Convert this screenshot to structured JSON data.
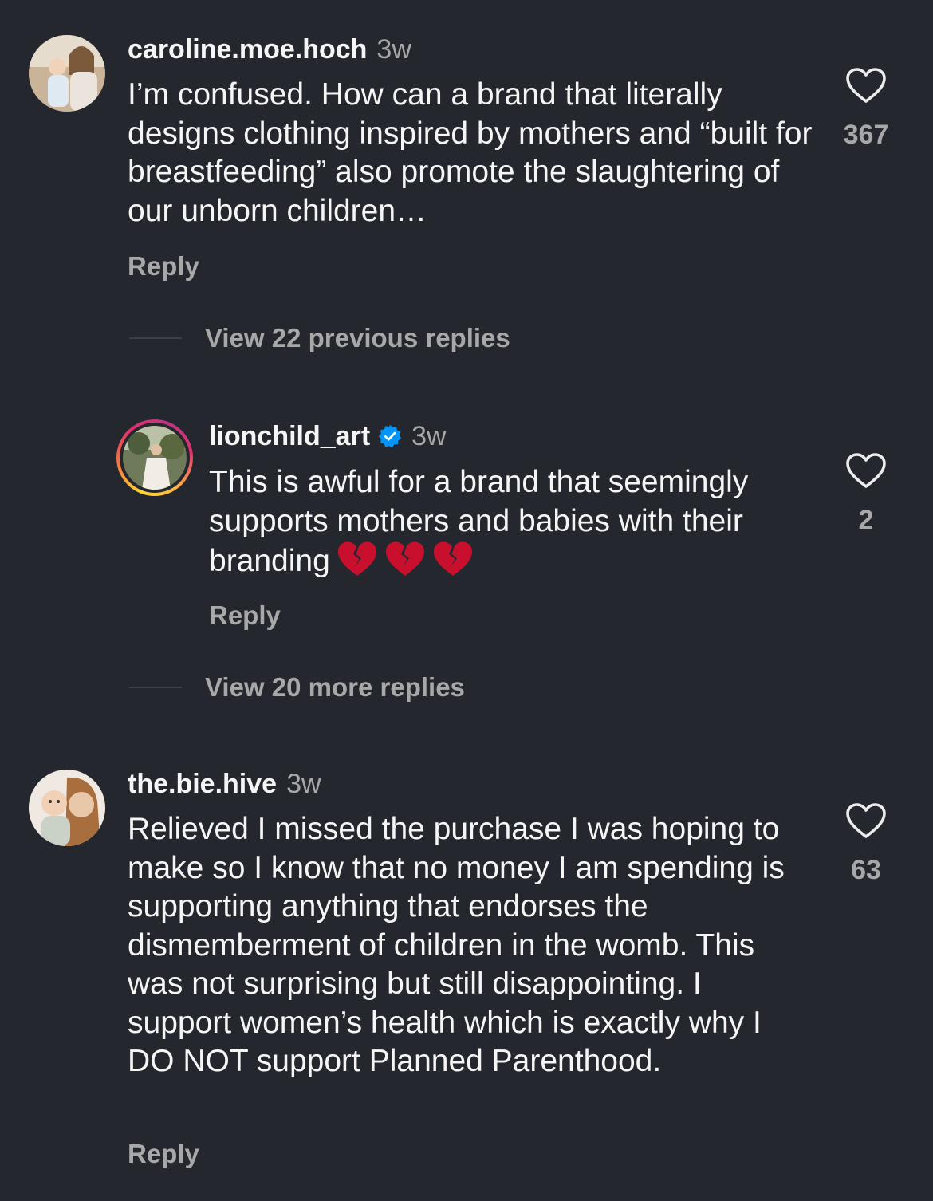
{
  "comments": [
    {
      "username": "caroline.moe.hoch",
      "time": "3w",
      "text": "I’m confused. How can a brand that literally designs clothing inspired by mothers and “built for breastfeeding” also promote the slaughtering of our unborn children…",
      "reply_label": "Reply",
      "likes": "367"
    },
    {
      "username": "lionchild_art",
      "verified": true,
      "time": "3w",
      "text": "This is awful for a brand that seemingly supports mothers and babies with their branding",
      "emojis": [
        "broken-heart",
        "broken-heart",
        "broken-heart"
      ],
      "reply_label": "Reply",
      "likes": "2"
    },
    {
      "username": "the.bie.hive",
      "time": "3w",
      "text": "Relieved I missed the purchase I was hoping to make so I know that no money I am spending is supporting anything that endorses the dismemberment of children in the womb. This was not surprising but still disappointing. I support women’s health which is exactly why I DO NOT support Planned Parenthood.",
      "reply_label": "Reply",
      "likes": "63"
    }
  ],
  "view_previous": "View 22 previous replies",
  "view_more": "View 20 more replies",
  "colors": {
    "background": "#25272e",
    "primary_text": "#f5f5f5",
    "secondary_text": "#a8a8a8",
    "verified_blue": "#0095f6"
  }
}
